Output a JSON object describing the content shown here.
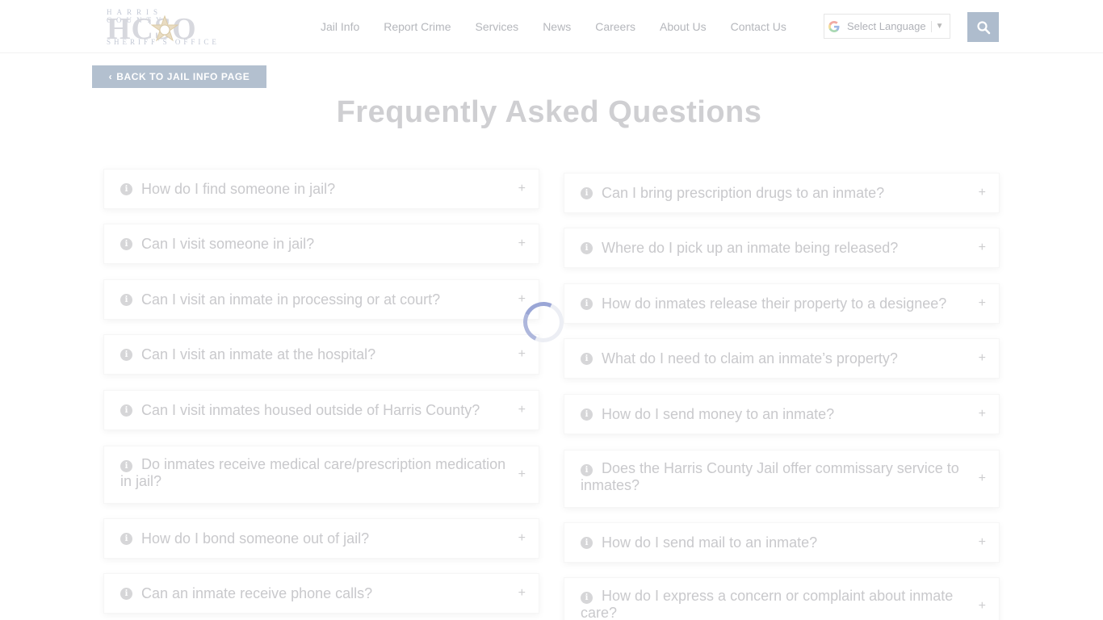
{
  "logo": {
    "top_text": "HARRIS COUNTY",
    "main_text": "HCSO",
    "bottom_text": "SHERIFF'S OFFICE"
  },
  "nav": {
    "items": [
      "Jail Info",
      "Report Crime",
      "Services",
      "News",
      "Careers",
      "About Us",
      "Contact Us"
    ]
  },
  "language": {
    "label": "Select Language",
    "arrow": "▼",
    "icon": "google-g-icon"
  },
  "search": {
    "icon": "search-icon"
  },
  "back_button": {
    "label": "BACK TO JAIL INFO PAGE",
    "icon": "chevron-left-icon"
  },
  "page_title": "Frequently Asked Questions",
  "faq_left": [
    "How do I find someone in jail?",
    "Can I visit someone in jail?",
    "Can I visit an inmate in processing or at court?",
    "Can I visit an inmate at the hospital?",
    "Can I visit inmates housed outside of Harris County?",
    "Do inmates receive medical care/prescription medication in jail?",
    "How do I bond someone out of jail?",
    "Can an inmate receive phone calls?"
  ],
  "faq_right": [
    "Can I bring prescription drugs to an inmate?",
    "Where do I pick up an inmate being released?",
    "How do inmates release their property to a designee?",
    "What do I need to claim an inmate’s property?",
    "How do I send money to an inmate?",
    "Does the Harris County Jail offer commissary service to inmates?",
    "How do I send mail to an inmate?",
    "How do I express a concern or complaint about inmate care?"
  ],
  "faq_icons": {
    "info": "info-icon",
    "expand": "plus-icon"
  },
  "expand_symbol": "+",
  "info_symbol": "i",
  "colors": {
    "accent": "#b3c0cf",
    "spinner": "#9aa6d6",
    "text_faded": "#c9c9cc"
  }
}
